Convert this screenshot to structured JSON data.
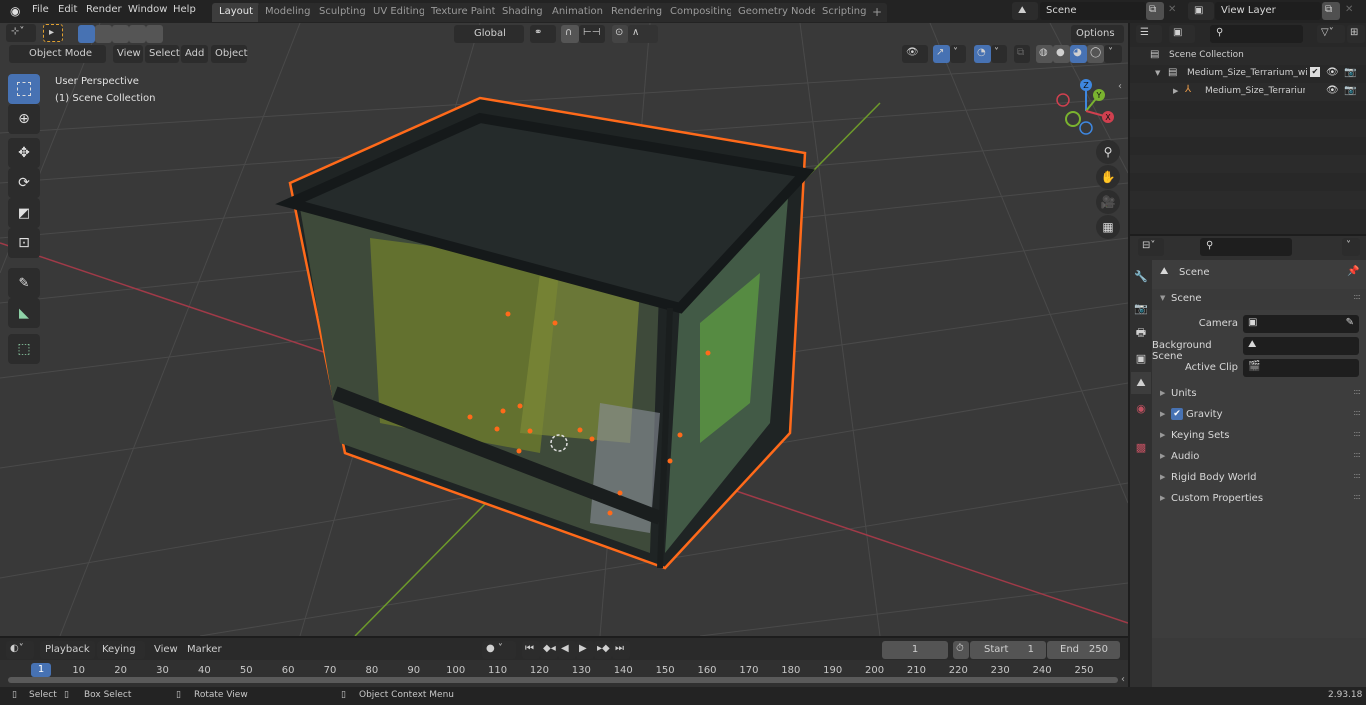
{
  "app": {
    "version": "2.93.18"
  },
  "topbar": {
    "menu": [
      "File",
      "Edit",
      "Render",
      "Window",
      "Help"
    ],
    "workspaces": [
      {
        "label": "Layout",
        "active": true
      },
      {
        "label": "Modeling",
        "active": false
      },
      {
        "label": "Sculpting",
        "active": false
      },
      {
        "label": "UV Editing",
        "active": false
      },
      {
        "label": "Texture Paint",
        "active": false
      },
      {
        "label": "Shading",
        "active": false
      },
      {
        "label": "Animation",
        "active": false
      },
      {
        "label": "Rendering",
        "active": false
      },
      {
        "label": "Compositing",
        "active": false
      },
      {
        "label": "Geometry Nodes",
        "active": false
      },
      {
        "label": "Scripting",
        "active": false
      }
    ],
    "add_workspace": "+",
    "scene_name": "Scene",
    "view_layer_name": "View Layer"
  },
  "viewport": {
    "header": {
      "mode": "Object Mode",
      "menus": [
        "View",
        "Select",
        "Add",
        "Object"
      ],
      "transform_orientation": "Global",
      "options_label": "Options"
    },
    "overlay_text": {
      "view_name": "User Perspective",
      "collection": "(1) Scene Collection"
    },
    "gizmo_axes": {
      "x": "X",
      "y": "Y",
      "z": "Z"
    },
    "colors": {
      "selection_outline": "#ff6a1a",
      "x_axis": "#d0404f",
      "y_axis": "#7ab32f",
      "z_axis": "#3e87e0",
      "active_button": "#4772b3"
    },
    "tools": [
      "select-box",
      "cursor",
      "move",
      "rotate",
      "scale",
      "transform",
      "annotate",
      "measure",
      "add-cube"
    ],
    "nav_buttons": [
      "zoom",
      "pan",
      "camera",
      "grid-ortho"
    ]
  },
  "outliner": {
    "search_placeholder": "",
    "root": "Scene Collection",
    "items": [
      {
        "label": "Medium_Size_Terrarium_with_",
        "type": "collection",
        "expanded": true,
        "checked": true
      },
      {
        "label": "Medium_Size_Terrarium_",
        "type": "empty",
        "expanded": false
      }
    ]
  },
  "properties": {
    "search_placeholder": "",
    "context_title": "Scene",
    "panels": {
      "scene": {
        "title": "Scene",
        "fields": [
          {
            "label": "Camera",
            "value": ""
          },
          {
            "label": "Background Scene",
            "value": ""
          },
          {
            "label": "Active Clip",
            "value": ""
          }
        ]
      },
      "collapsed": [
        {
          "label": "Units",
          "checkbox": false
        },
        {
          "label": "Gravity",
          "checkbox": true,
          "checked": true
        },
        {
          "label": "Keying Sets",
          "checkbox": false
        },
        {
          "label": "Audio",
          "checkbox": false
        },
        {
          "label": "Rigid Body World",
          "checkbox": false
        },
        {
          "label": "Custom Properties",
          "checkbox": false
        }
      ]
    },
    "tabs": [
      "tool",
      "render",
      "output",
      "view-layer",
      "scene",
      "world",
      "texture"
    ]
  },
  "timeline": {
    "menus": [
      "Playback",
      "Keying",
      "View",
      "Marker"
    ],
    "current_frame": "1",
    "start_label": "Start",
    "start": "1",
    "end_label": "End",
    "end": "250",
    "ruler": [
      "10",
      "20",
      "30",
      "40",
      "50",
      "60",
      "70",
      "80",
      "90",
      "100",
      "110",
      "120",
      "130",
      "140",
      "150",
      "160",
      "170",
      "180",
      "190",
      "200",
      "210",
      "220",
      "230",
      "240",
      "250"
    ],
    "playhead": "1"
  },
  "statusbar": {
    "items": [
      {
        "icon": "mouse-left-icon",
        "label": "Select"
      },
      {
        "icon": "mouse-drag-icon",
        "label": "Box Select"
      },
      {
        "icon": "mouse-middle-icon",
        "label": "Rotate View"
      },
      {
        "icon": "mouse-right-icon",
        "label": "Object Context Menu"
      }
    ]
  }
}
